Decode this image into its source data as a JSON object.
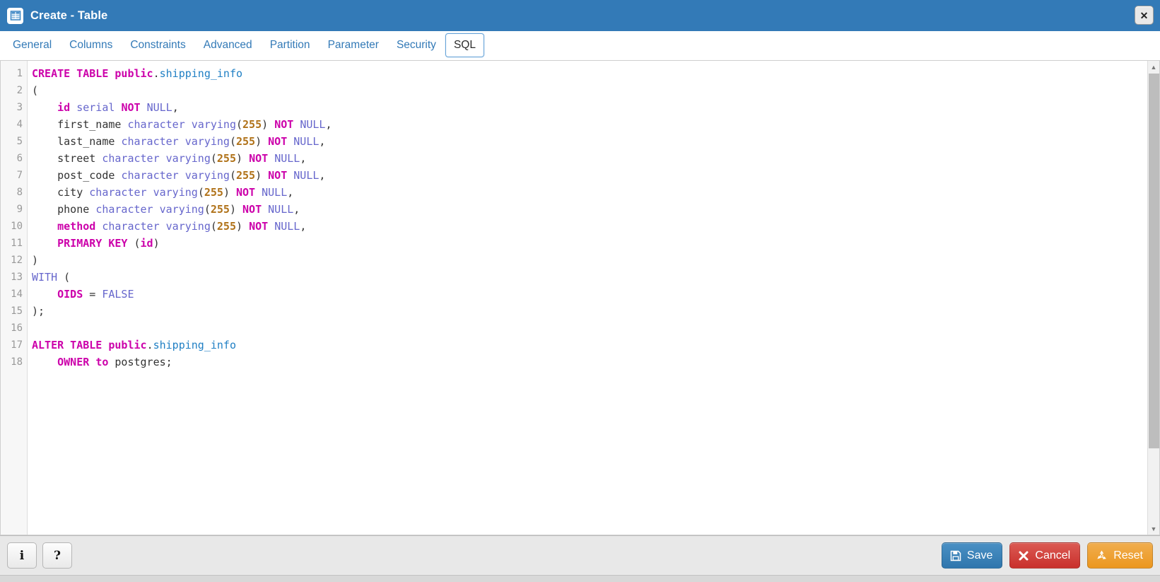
{
  "window": {
    "title": "Create - Table",
    "title_icon": "table-icon",
    "close_label": "✕",
    "accent_color": "#337ab7"
  },
  "tabs": [
    {
      "label": "General",
      "active": false
    },
    {
      "label": "Columns",
      "active": false
    },
    {
      "label": "Constraints",
      "active": false
    },
    {
      "label": "Advanced",
      "active": false
    },
    {
      "label": "Partition",
      "active": false
    },
    {
      "label": "Parameter",
      "active": false
    },
    {
      "label": "Security",
      "active": false
    },
    {
      "label": "SQL",
      "active": true
    }
  ],
  "editor": {
    "language": "sql",
    "line_count": 18,
    "line_numbers": [
      "1",
      "2",
      "3",
      "4",
      "5",
      "6",
      "7",
      "8",
      "9",
      "10",
      "11",
      "12",
      "13",
      "14",
      "15",
      "16",
      "17",
      "18"
    ],
    "plain_text": "CREATE TABLE public.shipping_info\n(\n    id serial NOT NULL,\n    first_name character varying(255) NOT NULL,\n    last_name character varying(255) NOT NULL,\n    street character varying(255) NOT NULL,\n    post_code character varying(255) NOT NULL,\n    city character varying(255) NOT NULL,\n    phone character varying(255) NOT NULL,\n    method character varying(255) NOT NULL,\n    PRIMARY KEY (id)\n)\nWITH (\n    OIDS = FALSE\n);\n\nALTER TABLE public.shipping_info\n    OWNER to postgres;",
    "lines": [
      [
        {
          "t": "CREATE TABLE ",
          "c": "kw"
        },
        {
          "t": "public",
          "c": "kw"
        },
        {
          "t": ".",
          "c": "pl"
        },
        {
          "t": "shipping_info",
          "c": "id"
        }
      ],
      [
        {
          "t": "(",
          "c": "pl"
        }
      ],
      [
        {
          "t": "    ",
          "c": "pl"
        },
        {
          "t": "id",
          "c": "kw"
        },
        {
          "t": " ",
          "c": "pl"
        },
        {
          "t": "serial",
          "c": "kw2"
        },
        {
          "t": " ",
          "c": "pl"
        },
        {
          "t": "NOT",
          "c": "kw"
        },
        {
          "t": " ",
          "c": "pl"
        },
        {
          "t": "NULL",
          "c": "kw2"
        },
        {
          "t": ",",
          "c": "pl"
        }
      ],
      [
        {
          "t": "    first_name ",
          "c": "pl"
        },
        {
          "t": "character varying",
          "c": "kw2"
        },
        {
          "t": "(",
          "c": "pl"
        },
        {
          "t": "255",
          "c": "num"
        },
        {
          "t": ") ",
          "c": "pl"
        },
        {
          "t": "NOT",
          "c": "kw"
        },
        {
          "t": " ",
          "c": "pl"
        },
        {
          "t": "NULL",
          "c": "kw2"
        },
        {
          "t": ",",
          "c": "pl"
        }
      ],
      [
        {
          "t": "    last_name ",
          "c": "pl"
        },
        {
          "t": "character varying",
          "c": "kw2"
        },
        {
          "t": "(",
          "c": "pl"
        },
        {
          "t": "255",
          "c": "num"
        },
        {
          "t": ") ",
          "c": "pl"
        },
        {
          "t": "NOT",
          "c": "kw"
        },
        {
          "t": " ",
          "c": "pl"
        },
        {
          "t": "NULL",
          "c": "kw2"
        },
        {
          "t": ",",
          "c": "pl"
        }
      ],
      [
        {
          "t": "    street ",
          "c": "pl"
        },
        {
          "t": "character varying",
          "c": "kw2"
        },
        {
          "t": "(",
          "c": "pl"
        },
        {
          "t": "255",
          "c": "num"
        },
        {
          "t": ") ",
          "c": "pl"
        },
        {
          "t": "NOT",
          "c": "kw"
        },
        {
          "t": " ",
          "c": "pl"
        },
        {
          "t": "NULL",
          "c": "kw2"
        },
        {
          "t": ",",
          "c": "pl"
        }
      ],
      [
        {
          "t": "    post_code ",
          "c": "pl"
        },
        {
          "t": "character varying",
          "c": "kw2"
        },
        {
          "t": "(",
          "c": "pl"
        },
        {
          "t": "255",
          "c": "num"
        },
        {
          "t": ") ",
          "c": "pl"
        },
        {
          "t": "NOT",
          "c": "kw"
        },
        {
          "t": " ",
          "c": "pl"
        },
        {
          "t": "NULL",
          "c": "kw2"
        },
        {
          "t": ",",
          "c": "pl"
        }
      ],
      [
        {
          "t": "    city ",
          "c": "pl"
        },
        {
          "t": "character varying",
          "c": "kw2"
        },
        {
          "t": "(",
          "c": "pl"
        },
        {
          "t": "255",
          "c": "num"
        },
        {
          "t": ") ",
          "c": "pl"
        },
        {
          "t": "NOT",
          "c": "kw"
        },
        {
          "t": " ",
          "c": "pl"
        },
        {
          "t": "NULL",
          "c": "kw2"
        },
        {
          "t": ",",
          "c": "pl"
        }
      ],
      [
        {
          "t": "    phone ",
          "c": "pl"
        },
        {
          "t": "character varying",
          "c": "kw2"
        },
        {
          "t": "(",
          "c": "pl"
        },
        {
          "t": "255",
          "c": "num"
        },
        {
          "t": ") ",
          "c": "pl"
        },
        {
          "t": "NOT",
          "c": "kw"
        },
        {
          "t": " ",
          "c": "pl"
        },
        {
          "t": "NULL",
          "c": "kw2"
        },
        {
          "t": ",",
          "c": "pl"
        }
      ],
      [
        {
          "t": "    ",
          "c": "pl"
        },
        {
          "t": "method",
          "c": "kw"
        },
        {
          "t": " ",
          "c": "pl"
        },
        {
          "t": "character varying",
          "c": "kw2"
        },
        {
          "t": "(",
          "c": "pl"
        },
        {
          "t": "255",
          "c": "num"
        },
        {
          "t": ") ",
          "c": "pl"
        },
        {
          "t": "NOT",
          "c": "kw"
        },
        {
          "t": " ",
          "c": "pl"
        },
        {
          "t": "NULL",
          "c": "kw2"
        },
        {
          "t": ",",
          "c": "pl"
        }
      ],
      [
        {
          "t": "    ",
          "c": "pl"
        },
        {
          "t": "PRIMARY KEY",
          "c": "kw"
        },
        {
          "t": " (",
          "c": "pl"
        },
        {
          "t": "id",
          "c": "kw"
        },
        {
          "t": ")",
          "c": "pl"
        }
      ],
      [
        {
          "t": ")",
          "c": "pl"
        }
      ],
      [
        {
          "t": "WITH",
          "c": "kw2"
        },
        {
          "t": " (",
          "c": "pl"
        }
      ],
      [
        {
          "t": "    ",
          "c": "pl"
        },
        {
          "t": "OIDS",
          "c": "kw"
        },
        {
          "t": " = ",
          "c": "pl"
        },
        {
          "t": "FALSE",
          "c": "kw2"
        }
      ],
      [
        {
          "t": ");",
          "c": "pl"
        }
      ],
      [
        {
          "t": "",
          "c": "pl"
        }
      ],
      [
        {
          "t": "ALTER TABLE ",
          "c": "kw"
        },
        {
          "t": "public",
          "c": "kw"
        },
        {
          "t": ".",
          "c": "pl"
        },
        {
          "t": "shipping_info",
          "c": "id"
        }
      ],
      [
        {
          "t": "    ",
          "c": "pl"
        },
        {
          "t": "OWNER",
          "c": "kw"
        },
        {
          "t": " ",
          "c": "pl"
        },
        {
          "t": "to",
          "c": "kw"
        },
        {
          "t": " postgres;",
          "c": "pl"
        }
      ]
    ]
  },
  "scrollbar": {
    "up_arrow": "▲",
    "down_arrow": "▼"
  },
  "footer": {
    "info_label": "i",
    "help_label": "?",
    "actions": [
      {
        "label": "Save",
        "icon": "floppy-disk-icon",
        "color": "#2f76ad",
        "name": "save-button"
      },
      {
        "label": "Cancel",
        "icon": "close-x-icon",
        "color": "#c9302c",
        "name": "cancel-button"
      },
      {
        "label": "Reset",
        "icon": "recycle-icon",
        "color": "#ec971f",
        "name": "reset-button"
      }
    ]
  }
}
